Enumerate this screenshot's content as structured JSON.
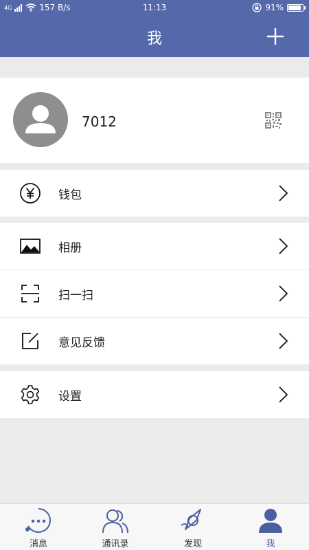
{
  "status_bar": {
    "network": "4G",
    "speed": "157 B/s",
    "time": "11:13",
    "battery": "91%",
    "battery_level": 0.91
  },
  "header": {
    "title": "我",
    "add_icon": "plus-icon"
  },
  "profile": {
    "username": "7012",
    "avatar_icon": "person-avatar",
    "qr_icon": "qr-code-icon"
  },
  "menu": {
    "wallet": {
      "label": "钱包",
      "icon": "yen-circle-icon"
    },
    "album": {
      "label": "相册",
      "icon": "image-icon"
    },
    "scan": {
      "label": "扫一扫",
      "icon": "scan-icon"
    },
    "feedback": {
      "label": "意见反馈",
      "icon": "edit-icon"
    },
    "settings": {
      "label": "设置",
      "icon": "gear-icon"
    }
  },
  "tabs": [
    {
      "label": "消息",
      "icon": "message-icon",
      "active": false
    },
    {
      "label": "通讯录",
      "icon": "contacts-icon",
      "active": false
    },
    {
      "label": "发现",
      "icon": "compass-icon",
      "active": false
    },
    {
      "label": "我",
      "icon": "person-icon",
      "active": true
    }
  ],
  "colors": {
    "primary": "#5468aa",
    "background": "#ebebeb",
    "tab_active": "#5468aa"
  }
}
